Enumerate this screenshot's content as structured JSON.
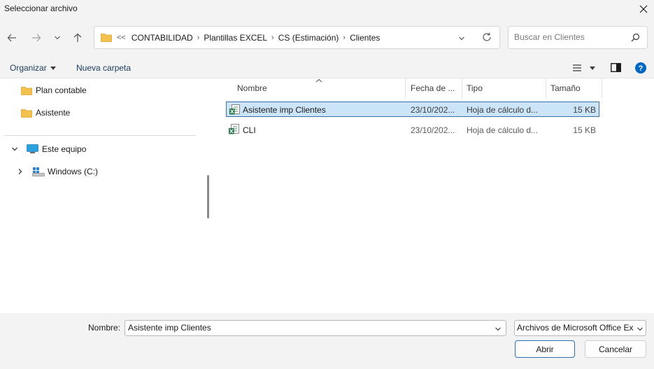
{
  "window": {
    "title": "Seleccionar archivo"
  },
  "nav": {
    "breadcrumb_overflow": "<<",
    "path": [
      "CONTABILIDAD",
      "Plantillas EXCEL",
      "CS (Estimación)",
      "Clientes"
    ],
    "search_placeholder": "Buscar en Clientes"
  },
  "toolbar": {
    "organize_label": "Organizar",
    "new_folder_label": "Nueva carpeta"
  },
  "sidebar": {
    "items": [
      {
        "label": "Plan contable",
        "icon": "folder-icon"
      },
      {
        "label": "Asistente",
        "icon": "folder-icon"
      }
    ],
    "this_pc": {
      "label": "Este equipo",
      "icon": "monitor-icon"
    },
    "drive": {
      "label": "Windows (C:)",
      "icon": "drive-icon"
    }
  },
  "columns": [
    "Nombre",
    "Fecha de ...",
    "Tipo",
    "Tamaño"
  ],
  "files": [
    {
      "name": "Asistente imp Clientes",
      "date": "23/10/202...",
      "type": "Hoja de cálculo d...",
      "size": "15 KB",
      "selected": true,
      "icon": "excel-file-icon"
    },
    {
      "name": "CLI",
      "date": "23/10/202...",
      "type": "Hoja de cálculo d...",
      "size": "15 KB",
      "selected": false,
      "icon": "excel-file-icon"
    }
  ],
  "footer": {
    "name_label": "Nombre:",
    "name_value": "Asistente imp Clientes",
    "filetype_value": "Archivos de Microsoft Office Ex",
    "open_label": "Abrir",
    "cancel_label": "Cancelar"
  },
  "colors": {
    "accent": "#0067c0",
    "selection_bg": "#cce4f7",
    "selection_border": "#3b6ea5",
    "folder": "#f2c14e",
    "excel_green": "#1e7145"
  }
}
